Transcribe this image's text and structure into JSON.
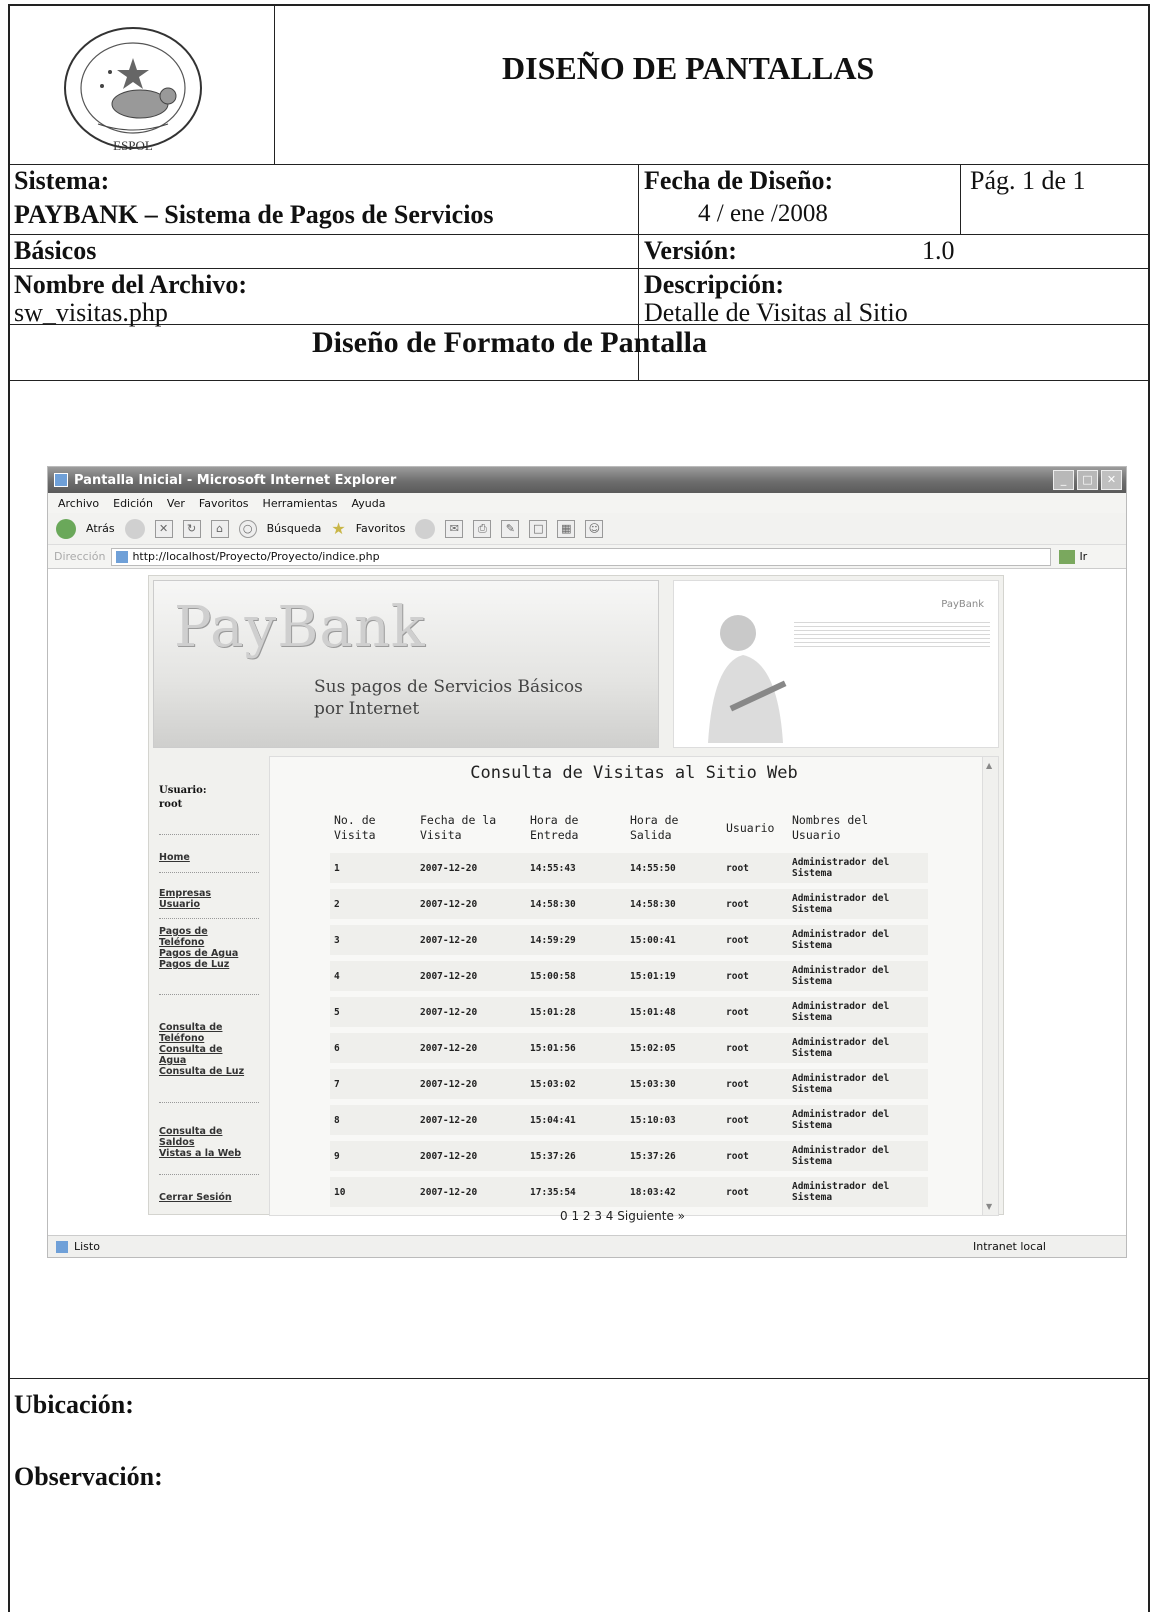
{
  "header": {
    "title": "DISEÑO DE PANTALLAS",
    "seal_text": "ESCUELA SUPERIOR POLITÉCNICA DEL LITORAL",
    "seal_label": "ESPOL"
  },
  "info": {
    "sistema_label": "Sistema:",
    "sistema_value_line1": "PAYBANK – Sistema de Pagos de Servicios",
    "sistema_value_line2": "Básicos",
    "fecha_label": "Fecha de Diseño:",
    "fecha_value": "4 / ene /2008",
    "pagina": "Pág. 1 de 1",
    "version_label": "Versión:",
    "version_value": "1.0",
    "archivo_label": "Nombre del Archivo:",
    "archivo_value": "sw_visitas.php",
    "descripcion_label": "Descripción:",
    "descripcion_value": "Detalle de Visitas al Sitio"
  },
  "section_title": "Diseño de Formato de Pantalla",
  "browser": {
    "window_title": "Pantalla Inicial - Microsoft Internet Explorer",
    "menu": [
      "Archivo",
      "Edición",
      "Ver",
      "Favoritos",
      "Herramientas",
      "Ayuda"
    ],
    "back_label": "Atrás",
    "search_label": "Búsqueda",
    "favorites_label": "Favoritos",
    "address_label": "Dirección",
    "url": "http://localhost/Proyecto/Proyecto/indice.php",
    "go_label": "Ir",
    "status_left": "Listo",
    "status_right": "Intranet local"
  },
  "site": {
    "logo": "PayBank",
    "slogan_line1": "Sus pagos de Servicios Básicos",
    "slogan_line2": "por Internet",
    "brand_small": "PayBank",
    "user_label": "Usuario:",
    "user_value": "root",
    "nav": {
      "home": "Home",
      "empresas": "Empresas",
      "usuario": "Usuario",
      "pagos_tel_1": "Pagos de",
      "pagos_tel_2": "Teléfono",
      "pagos_agua": "Pagos de Agua",
      "pagos_luz": "Pagos de Luz",
      "cons_tel_1": "Consulta de",
      "cons_tel_2": "Teléfono",
      "cons_agua_1": "Consulta de",
      "cons_agua_2": "Agua",
      "cons_luz": "Consulta de Luz",
      "cons_saldos_1": "Consulta de",
      "cons_saldos_2": "Saldos",
      "visitas": "Vistas a la Web",
      "cerrar": "Cerrar Sesión"
    },
    "content_title": "Consulta de Visitas al Sitio Web",
    "columns": [
      [
        "No. de",
        "Visita"
      ],
      [
        "Fecha de la",
        "Visita"
      ],
      [
        "Hora de",
        "Entreda"
      ],
      [
        "Hora de",
        "Salida"
      ],
      [
        "Usuario",
        ""
      ],
      [
        "Nombres del",
        "Usuario"
      ]
    ],
    "rows": [
      [
        "1",
        "2007-12-20",
        "14:55:43",
        "14:55:50",
        "root",
        "Administrador del",
        "Sistema"
      ],
      [
        "2",
        "2007-12-20",
        "14:58:30",
        "14:58:30",
        "root",
        "Administrador del",
        "Sistema"
      ],
      [
        "3",
        "2007-12-20",
        "14:59:29",
        "15:00:41",
        "root",
        "Administrador del",
        "Sistema"
      ],
      [
        "4",
        "2007-12-20",
        "15:00:58",
        "15:01:19",
        "root",
        "Administrador del",
        "Sistema"
      ],
      [
        "5",
        "2007-12-20",
        "15:01:28",
        "15:01:48",
        "root",
        "Administrador del",
        "Sistema"
      ],
      [
        "6",
        "2007-12-20",
        "15:01:56",
        "15:02:05",
        "root",
        "Administrador del",
        "Sistema"
      ],
      [
        "7",
        "2007-12-20",
        "15:03:02",
        "15:03:30",
        "root",
        "Administrador del",
        "Sistema"
      ],
      [
        "8",
        "2007-12-20",
        "15:04:41",
        "15:10:03",
        "root",
        "Administrador del",
        "Sistema"
      ],
      [
        "9",
        "2007-12-20",
        "15:37:26",
        "15:37:26",
        "root",
        "Administrador del",
        "Sistema"
      ],
      [
        "10",
        "2007-12-20",
        "17:35:54",
        "18:03:42",
        "root",
        "Administrador del",
        "Sistema"
      ]
    ],
    "pager": "0 1 2 3 4 Siguiente »"
  },
  "footer": {
    "ubicacion_label": "Ubicación:",
    "observacion_label": "Observación:"
  }
}
